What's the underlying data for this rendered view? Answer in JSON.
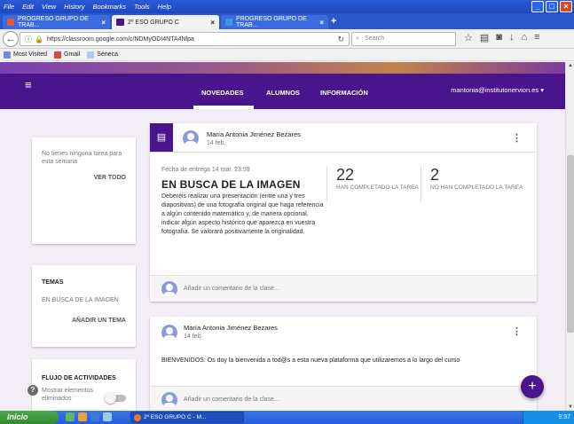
{
  "browser": {
    "menu": [
      "File",
      "Edit",
      "View",
      "History",
      "Bookmarks",
      "Tools",
      "Help"
    ],
    "tabs": [
      {
        "label": "PROGRESO GRUPO DE TRAB...",
        "active": false,
        "icon_color": "#e25a3a"
      },
      {
        "label": "2º ESO GRUPO C",
        "active": true,
        "icon_color": "#4a148c"
      },
      {
        "label": "PROGRESO GRUPO DE TRAB...",
        "active": false,
        "icon_color": "#3a9ad9"
      }
    ],
    "tab_close": "×",
    "new_tab": "+",
    "url": "https://classroom.google.com/c/NDMyODI4NTA4Nlpa",
    "search_placeholder": "Search",
    "bookmarks": [
      "Most Visited",
      "Gmail",
      "Séneca"
    ]
  },
  "classroom": {
    "nav_tabs": [
      "NOVEDADES",
      "ALUMNOS",
      "INFORMACIÓN"
    ],
    "user_email": "mantonia@institutonervion.es ▾",
    "upcoming": {
      "text": "No tienes ninguna tarea para esta semana",
      "link": "VER TODO"
    },
    "topics": {
      "title": "TEMAS",
      "item": "EN BUSCA DE LA IMAGEN",
      "link": "AÑADIR UN TEMA"
    },
    "flow": {
      "title": "FLUJO DE ACTIVIDADES",
      "toggle_label": "Mostrar elementos eliminados",
      "toggle_on": false
    },
    "posts": [
      {
        "author": "María Antonia Jiménez Bezares",
        "date": "14 feb.",
        "due": "Fecha de entrega 14 mar. 23:59",
        "title": "EN BUSCA DE LA IMAGEN",
        "description": "Deberéis realizar una presentación (entre una y tres diapositivas) de una fotografía original que haga referencia a algún contenido matemático y, de manera opcional, indicar algún aspecto histórico que aparezca en vuestra fotografía. Se valorará positivamente la originalidad.",
        "completed": "22",
        "completed_label": "HAN COMPLETADO LA TAREA",
        "not_completed": "2",
        "not_completed_label": "NO HAN COMPLETADO LA TAREA",
        "comment_placeholder": "Añadir un comentario de la clase..."
      },
      {
        "author": "María Antonia Jiménez Bezares",
        "date": "14 feb.",
        "text": "BIENVENIDOS: Os doy la bienvenida a tod@s a esta nueva plataforma que utilizaremos a lo largo del curso",
        "comment_placeholder": "Añadir un comentario de la clase..."
      }
    ],
    "fab_label": "+",
    "help_label": "?"
  },
  "taskbar": {
    "start": "Inicio",
    "task": "2º ESO GRUPO C - M...",
    "clock": "9:37"
  }
}
